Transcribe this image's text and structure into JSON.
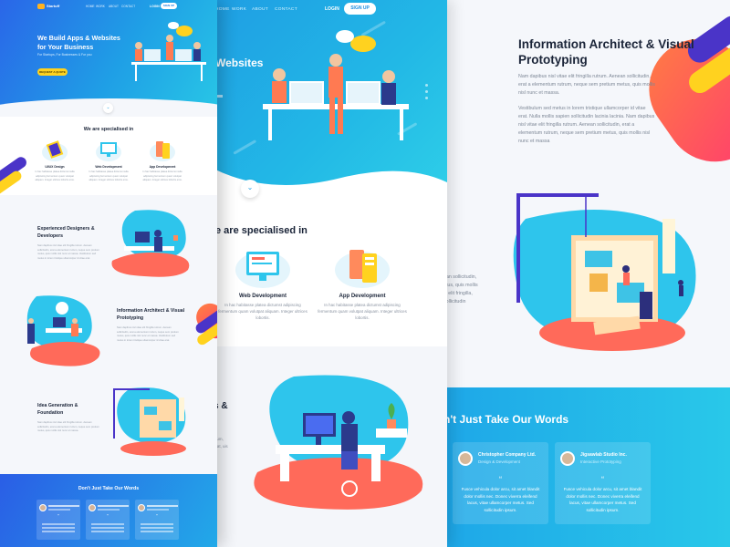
{
  "panel1": {
    "brand": "Startuff",
    "nav": [
      "HOME",
      "WORK",
      "ABOUT",
      "CONTACT"
    ],
    "login": "LOGIN",
    "signup": "SIGN UP",
    "hero_title": "We Build Apps & Websites for Your Business",
    "hero_sub": "For Startups, For Businesses & For you",
    "hero_button": "REQUEST A QUOTE",
    "specialised_title": "We are specialised in",
    "services": [
      {
        "title": "UI/UX Design",
        "text": "In hac habitasse platea dictumst nulla adipiscing fermentum quam volutpat aliquam. Integer ultrices lobortis eros."
      },
      {
        "title": "Web Development",
        "text": "In hac habitasse platea dictumst nulla adipiscing fermentum quam volutpat aliquam. Integer ultrices lobortis eros."
      },
      {
        "title": "App Development",
        "text": "In hac habitasse platea dictumst nulla adipiscing fermentum quam volutpat aliquam. Integer ultrices lobortis eros."
      }
    ],
    "sections": [
      {
        "title": "Experienced Designers & Developers",
        "text": "Nam dapibus nisl vitae elit fringilla rutrum. Aenean sollicitudin, erat a elementum rutrum, neque sem pretium metus, quis mollis nisl nunc et massa. Vestibulum sed metus in lorem tristique ullamcorper id vitae erat."
      },
      {
        "title": "Information Architect & Visual Prototyping",
        "text": "Nam dapibus nisl vitae elit fringilla rutrum. Aenean sollicitudin, erat a elementum rutrum, neque sem pretium metus, quis mollis nisl nunc et massa. Vestibulum sed metus in lorem tristique ullamcorper id vitae erat."
      },
      {
        "title": "Idea Generation & Foundation",
        "text": "Nam dapibus nisl vitae elit fringilla rutrum. Aenean sollicitudin, erat a elementum rutrum, neque sem pretium metus, quis mollis nisl nunc et massa."
      }
    ],
    "testimonials_title": "Don't Just Take Our Words"
  },
  "panel2": {
    "nav": [
      "HOME",
      "WORK",
      "ABOUT",
      "CONTACT"
    ],
    "login": "LOGIN",
    "signup": "SIGN UP",
    "hero_word": "Websites",
    "scroll_icon": "chevron-down-icon",
    "specialised_title": "e are specialised in",
    "services": [
      {
        "title": "Web Development",
        "text": "In hac habitasse platea dictumst adipiscing fermentum quam volutpat aliquam. Integer ultrices lobortis."
      },
      {
        "title": "App Development",
        "text": "In hac habitasse platea dictumst adipiscing fermentum quam volutpat aliquam. Integer ultrices lobortis."
      }
    ],
    "mid_heading": "s &",
    "mid_text": "ctum, erat, uis si"
  },
  "panel3": {
    "title": "Information Architect & Visual Prototyping",
    "para1": "Nam dapibus nisl vitae elit fringilla rutrum. Aenean sollicitudin, erat a elementum rutrum, neque sem pretium metus, quis mollis nisl nunc et massa.",
    "para2": "Vestibulum sed metus in lorem tristique ullamcorper id vitae erat. Nulla mollis sapien sollicitudin lacinia lacinia. Nam dapibus nisl vitae elit fringilla rutrum. Aenean sollicitudin, erat a elementum rutrum, neque sem pretium metus, quis mollis nisl nunc et massa",
    "left_cut_text": "ean sollicitudin, etus, quis mollis is elit fringilla, sollicitudin",
    "testimonials_title": "n't Just Take Our Words",
    "testimonials": [
      {
        "name": "Christopher Company Ltd.",
        "role": "Design & Development",
        "quote_mark": "“",
        "text": "Fusce vehicula dolor arcu, sit amet blandit dolor mollis nec. Donec viverra eleifend lacus, vitae ullamcorper metus. Sed sollicitudin ipsum."
      },
      {
        "name": "Jigsawlab Studio Inc.",
        "role": "Interactive Prototyping",
        "quote_mark": "“",
        "text": "Fusce vehicula dolor arcu, sit amet blandit dolor mollis nec. Donec viverra eleifend lacus, vitae ullamcorper metus. Sed sollicitudin ipsum."
      }
    ]
  },
  "colors": {
    "hero_blue": "#1f9ee3",
    "hero_indigo": "#2a66e8",
    "accent_yellow": "#ffd21f",
    "accent_coral": "#ff6a5a",
    "accent_purple": "#4a34c8",
    "heading": "#1a2438",
    "body_text": "#7d8796"
  }
}
